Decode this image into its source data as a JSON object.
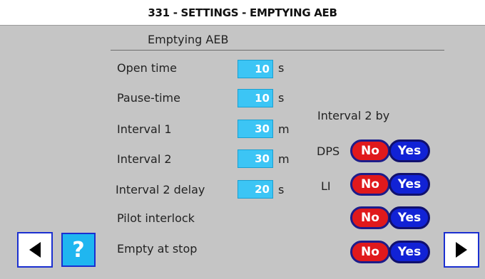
{
  "title": "331 - SETTINGS - EMPTYING AEB",
  "section_title": "Emptying AEB",
  "fields": [
    {
      "label": "Open time",
      "value": "10",
      "unit": "s"
    },
    {
      "label": "Pause-time",
      "value": "10",
      "unit": "s"
    },
    {
      "label": "Interval 1",
      "value": "30",
      "unit": "m"
    },
    {
      "label": "Interval 2",
      "value": "30",
      "unit": "m"
    },
    {
      "label": "Interval 2 delay",
      "value": "20",
      "unit": "s"
    }
  ],
  "interval2_by": {
    "heading": "Interval 2 by",
    "dps_label": "DPS",
    "li_label": "LI"
  },
  "pilot_interlock_label": "Pilot interlock",
  "empty_at_stop_label": "Empty at stop",
  "toggles": {
    "no_label": "No",
    "yes_label": "Yes"
  },
  "nav": {
    "help_label": "?",
    "back_icon": "triangle-left-icon",
    "forward_icon": "triangle-right-icon"
  },
  "colors": {
    "input_fill": "#3cc5f5",
    "no_red": "#e0191c",
    "yes_blue": "#1122d6",
    "nav_border": "#1a2fd0",
    "help_fill": "#1fb6f0"
  }
}
